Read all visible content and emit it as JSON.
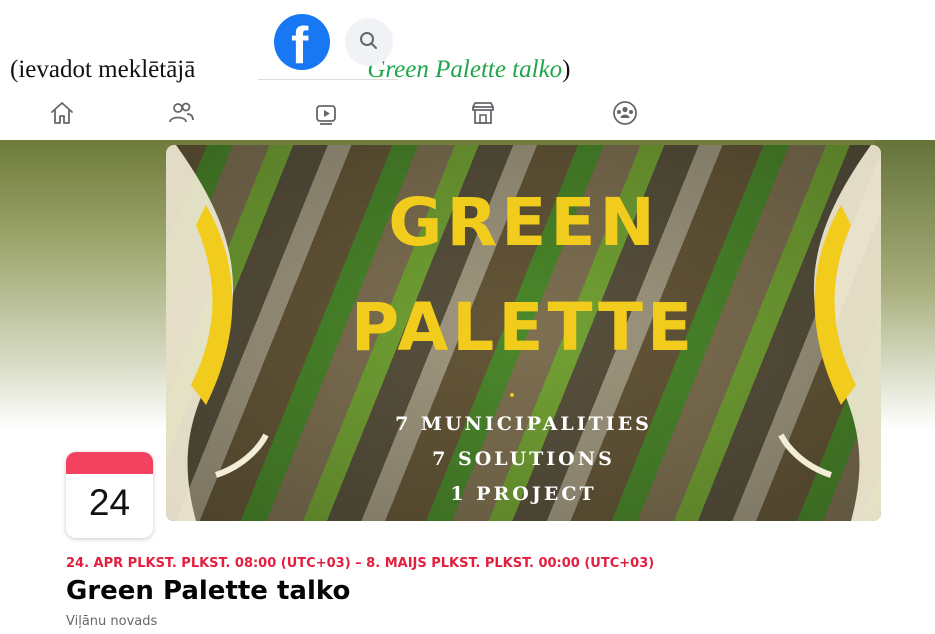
{
  "caption": {
    "prefix": "(ievadot meklētājā",
    "query": "Green Palette talko",
    "suffix": ")"
  },
  "facebook": {
    "logo_letter": "f",
    "brand_color": "#1877f2"
  },
  "navbar": {
    "icons": [
      "home-icon",
      "friends-icon",
      "watch-icon",
      "marketplace-icon",
      "groups-icon"
    ]
  },
  "cover": {
    "title_line1": "GREEN",
    "title_line2": "PALETTE",
    "subtitle_line1": "7 MUNICIPALITIES",
    "subtitle_line2": "7 SOLUTIONS",
    "subtitle_line3": "1 PROJECT",
    "title_color": "#f2cc1d"
  },
  "event": {
    "day": "24",
    "date_range": "24. APR PLKST. PLKST. 08:00 (UTC+03) – 8. MAIJS PLKST. PLKST. 00:00 (UTC+03)",
    "title": "Green Palette talko",
    "location": "Viļānu novads",
    "accent_color": "#f3425f"
  }
}
